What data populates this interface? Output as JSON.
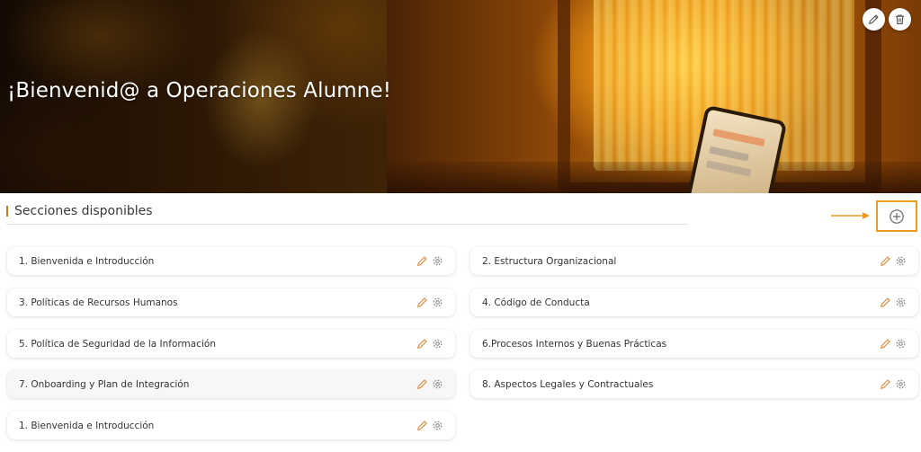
{
  "banner": {
    "title": "¡Bienvenid@ a Operaciones Alumne!",
    "edit_icon": "pencil-icon",
    "delete_icon": "trash-icon"
  },
  "sections_header": {
    "title": "Secciones disponibles",
    "add_icon": "plus-circle-icon"
  },
  "colors": {
    "accent": "#f39a1e",
    "edit_icon": "#e08a3c",
    "settings_icon": "#8a8a8a"
  },
  "sections": [
    {
      "label": "1. Bienvenida e Introducción"
    },
    {
      "label": "2. Estructura Organizacional"
    },
    {
      "label": "3. Políticas de Recursos Humanos"
    },
    {
      "label": "4. Código de Conducta"
    },
    {
      "label": "5. Política de Seguridad de la Información"
    },
    {
      "label": "6.Procesos Internos y Buenas Prácticas"
    },
    {
      "label": "7. Onboarding y Plan de Integración"
    },
    {
      "label": "8. Aspectos Legales y Contractuales"
    },
    {
      "label": "1. Bienvenida e Introducción"
    }
  ]
}
